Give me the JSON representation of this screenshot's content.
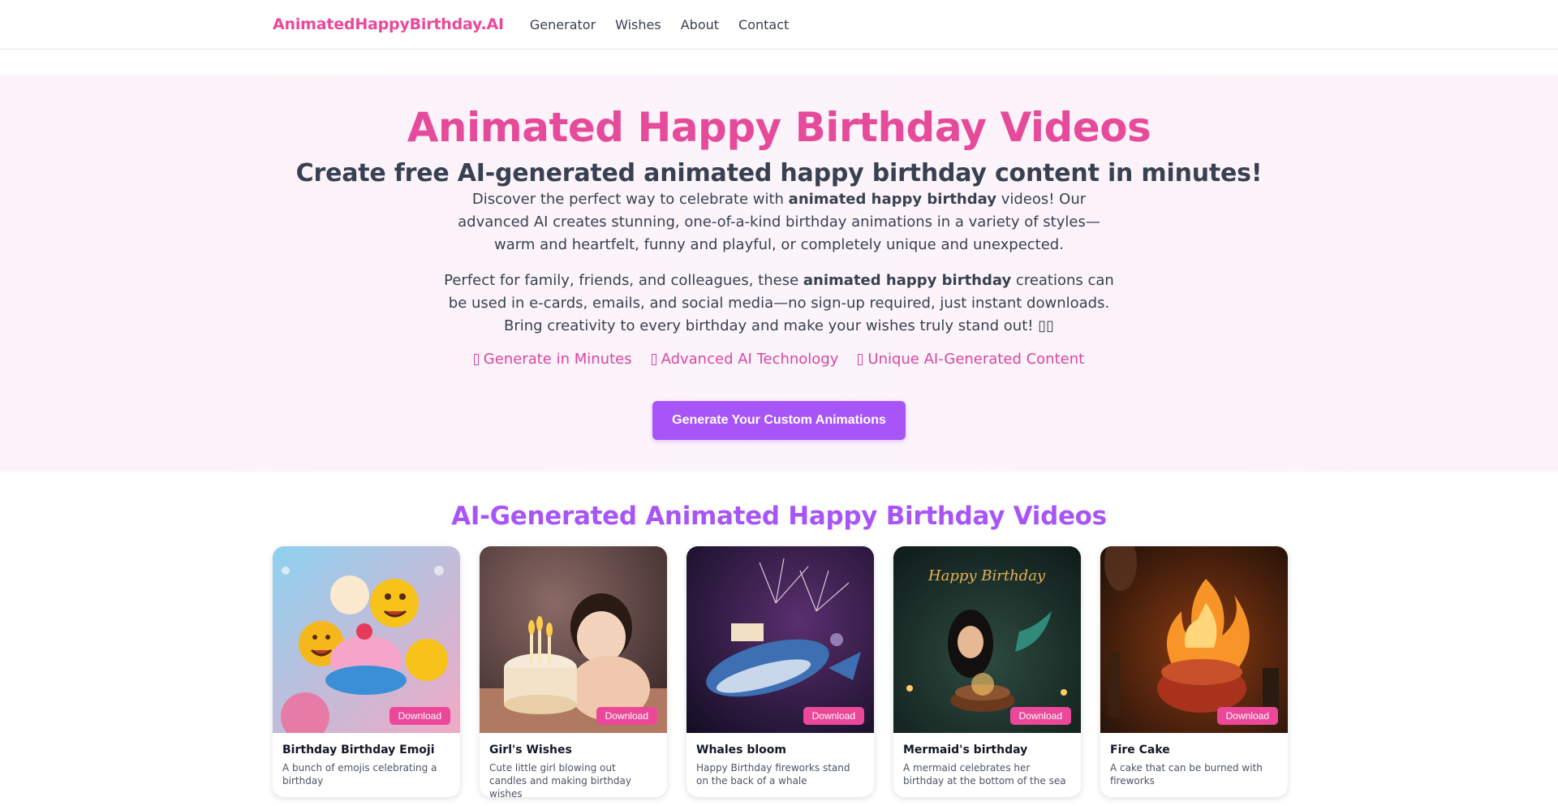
{
  "nav": {
    "brand": "AnimatedHappyBirthday.AI",
    "links": [
      "Generator",
      "Wishes",
      "About",
      "Contact"
    ]
  },
  "hero": {
    "title": "Animated Happy Birthday Videos",
    "subtitle": "Create free AI-generated animated happy birthday content in minutes!",
    "p1": {
      "before": "Discover the perfect way to celebrate with ",
      "bold": "animated happy birthday",
      "after": " videos! Our advanced AI creates stunning, one-of-a-kind birthday animations in a variety of styles—warm and heartfelt, funny and playful, or completely unique and unexpected."
    },
    "p2": {
      "before": "Perfect for family, friends, and colleagues, these ",
      "bold": "animated happy birthday",
      "after": " creations can be used in e-cards, emails, and social media—no sign-up required, just instant downloads. Bring creativity to every birthday and make your wishes truly stand out! ▯▯"
    },
    "features": [
      "Generate in Minutes",
      "Advanced AI Technology",
      "Unique AI-Generated Content"
    ],
    "cta": "Generate Your Custom Animations"
  },
  "gallery": {
    "title": "AI-Generated Animated Happy Birthday Videos",
    "download_label": "Download",
    "cards": [
      {
        "title": "Birthday Birthday Emoji",
        "desc": "A bunch of emojis celebrating a birthday"
      },
      {
        "title": "Girl's Wishes",
        "desc": "Cute little girl blowing out candles and making birthday wishes"
      },
      {
        "title": "Whales bloom",
        "desc": "Happy Birthday fireworks stand on the back of a whale"
      },
      {
        "title": "Mermaid's birthday",
        "desc": "A mermaid celebrates her birthday at the bottom of the sea"
      },
      {
        "title": "Fire Cake",
        "desc": "A cake that can be burned with fireworks"
      }
    ],
    "image_text": {
      "mermaid": "Happy Birthday"
    }
  },
  "colors": {
    "brand_pink": "#ec4899",
    "accent_purple": "#a855f7",
    "hero_bg": "#fdf2f8"
  }
}
